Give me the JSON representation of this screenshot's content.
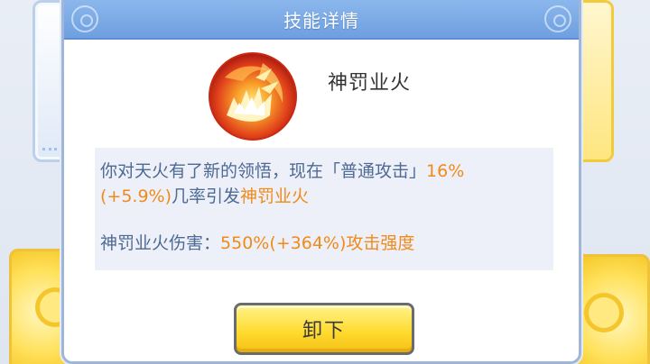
{
  "dialog": {
    "title": "技能详情"
  },
  "skill": {
    "icon": "fire-burst-icon",
    "name": "神罚业火"
  },
  "description": {
    "line1_prefix": "你对天火有了新的领悟，现在「普通攻击」",
    "line1_rate": "16%",
    "line2_rate_bonus": "(+5.9%)",
    "line2_mid": "几率引发",
    "line2_skill": "神罚业火",
    "damage_label": "神罚业火伤害：",
    "damage_value": "550%(+364%)",
    "damage_suffix": "攻击强度"
  },
  "actions": {
    "unequip_label": "卸下"
  },
  "colors": {
    "header": "#7aaae6",
    "highlight": "#f08a18",
    "body_text": "#4d6a94",
    "button": "#ffd92c"
  }
}
